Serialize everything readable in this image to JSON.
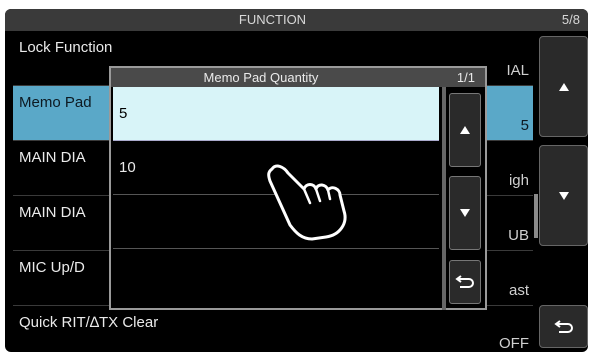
{
  "header": {
    "title": "FUNCTION",
    "page": "5/8"
  },
  "rows": [
    {
      "label": "Lock Function",
      "value": "IAL"
    },
    {
      "label": "Memo Pad",
      "value": "5"
    },
    {
      "label": "MAIN DIA",
      "value": "igh"
    },
    {
      "label": "MAIN DIA",
      "value": "UB"
    },
    {
      "label": "MIC Up/D",
      "value": "ast"
    },
    {
      "label": "Quick RIT/∆TX Clear",
      "value": "OFF"
    }
  ],
  "dialog": {
    "title": "Memo Pad Quantity",
    "page": "1/1",
    "options": [
      "5",
      "10",
      "",
      ""
    ]
  },
  "icons": {
    "up": "up-arrow-icon",
    "down": "down-arrow-icon",
    "return": "return-icon",
    "hand": "pointing-hand-icon"
  },
  "colors": {
    "selected_row": "#5aa8c8",
    "selected_option": "#d8f4f8"
  }
}
